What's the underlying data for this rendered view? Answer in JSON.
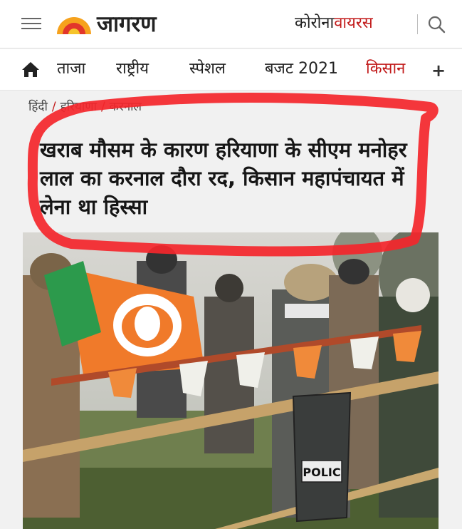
{
  "header": {
    "logo_text": "जागरण",
    "corona_part1": "कोरोना",
    "corona_part2": "वायरस",
    "accent_color": "#c21b1b"
  },
  "nav": {
    "items": [
      {
        "label": "ताजा"
      },
      {
        "label": "राष्ट्रीय"
      },
      {
        "label": "स्पेशल"
      },
      {
        "label": "बजट 2021"
      },
      {
        "label": "किसान"
      }
    ],
    "more_symbol": "+"
  },
  "breadcrumb": {
    "items": [
      "हिंदी",
      "हरियाणा",
      "करनाल"
    ],
    "separator": "/"
  },
  "article": {
    "headline": "खराब मौसम के कारण हरियाणा के सीएम मनोहर लाल का करनाल दौरा रद, किसान महापंचायत में लेना था हिस्सा",
    "photo": {
      "shield_text": "POLIC"
    }
  },
  "annotation": {
    "stroke_color": "#f4262b"
  }
}
